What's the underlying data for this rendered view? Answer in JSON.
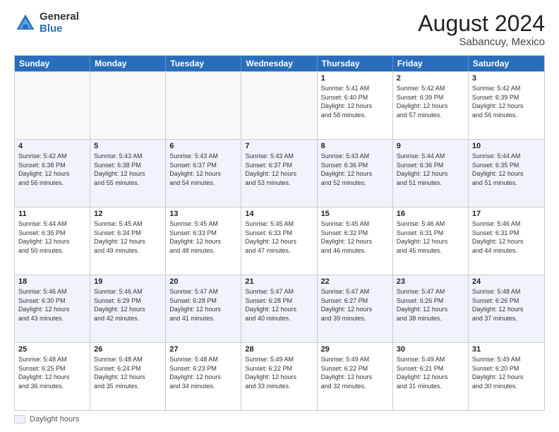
{
  "logo": {
    "general": "General",
    "blue": "Blue"
  },
  "title": "August 2024",
  "location": "Sabancuy, Mexico",
  "days_header": [
    "Sunday",
    "Monday",
    "Tuesday",
    "Wednesday",
    "Thursday",
    "Friday",
    "Saturday"
  ],
  "legend_text": "Daylight hours",
  "rows": [
    [
      {
        "day": "",
        "lines": []
      },
      {
        "day": "",
        "lines": []
      },
      {
        "day": "",
        "lines": []
      },
      {
        "day": "",
        "lines": []
      },
      {
        "day": "1",
        "lines": [
          "Sunrise: 5:41 AM",
          "Sunset: 6:40 PM",
          "Daylight: 12 hours",
          "and 58 minutes."
        ]
      },
      {
        "day": "2",
        "lines": [
          "Sunrise: 5:42 AM",
          "Sunset: 6:39 PM",
          "Daylight: 12 hours",
          "and 57 minutes."
        ]
      },
      {
        "day": "3",
        "lines": [
          "Sunrise: 5:42 AM",
          "Sunset: 6:39 PM",
          "Daylight: 12 hours",
          "and 56 minutes."
        ]
      }
    ],
    [
      {
        "day": "4",
        "lines": [
          "Sunrise: 5:42 AM",
          "Sunset: 6:38 PM",
          "Daylight: 12 hours",
          "and 56 minutes."
        ]
      },
      {
        "day": "5",
        "lines": [
          "Sunrise: 5:43 AM",
          "Sunset: 6:38 PM",
          "Daylight: 12 hours",
          "and 55 minutes."
        ]
      },
      {
        "day": "6",
        "lines": [
          "Sunrise: 5:43 AM",
          "Sunset: 6:37 PM",
          "Daylight: 12 hours",
          "and 54 minutes."
        ]
      },
      {
        "day": "7",
        "lines": [
          "Sunrise: 5:43 AM",
          "Sunset: 6:37 PM",
          "Daylight: 12 hours",
          "and 53 minutes."
        ]
      },
      {
        "day": "8",
        "lines": [
          "Sunrise: 5:43 AM",
          "Sunset: 6:36 PM",
          "Daylight: 12 hours",
          "and 52 minutes."
        ]
      },
      {
        "day": "9",
        "lines": [
          "Sunrise: 5:44 AM",
          "Sunset: 6:36 PM",
          "Daylight: 12 hours",
          "and 51 minutes."
        ]
      },
      {
        "day": "10",
        "lines": [
          "Sunrise: 5:44 AM",
          "Sunset: 6:35 PM",
          "Daylight: 12 hours",
          "and 51 minutes."
        ]
      }
    ],
    [
      {
        "day": "11",
        "lines": [
          "Sunrise: 5:44 AM",
          "Sunset: 6:35 PM",
          "Daylight: 12 hours",
          "and 50 minutes."
        ]
      },
      {
        "day": "12",
        "lines": [
          "Sunrise: 5:45 AM",
          "Sunset: 6:34 PM",
          "Daylight: 12 hours",
          "and 49 minutes."
        ]
      },
      {
        "day": "13",
        "lines": [
          "Sunrise: 5:45 AM",
          "Sunset: 6:33 PM",
          "Daylight: 12 hours",
          "and 48 minutes."
        ]
      },
      {
        "day": "14",
        "lines": [
          "Sunrise: 5:45 AM",
          "Sunset: 6:33 PM",
          "Daylight: 12 hours",
          "and 47 minutes."
        ]
      },
      {
        "day": "15",
        "lines": [
          "Sunrise: 5:45 AM",
          "Sunset: 6:32 PM",
          "Daylight: 12 hours",
          "and 46 minutes."
        ]
      },
      {
        "day": "16",
        "lines": [
          "Sunrise: 5:46 AM",
          "Sunset: 6:31 PM",
          "Daylight: 12 hours",
          "and 45 minutes."
        ]
      },
      {
        "day": "17",
        "lines": [
          "Sunrise: 5:46 AM",
          "Sunset: 6:31 PM",
          "Daylight: 12 hours",
          "and 44 minutes."
        ]
      }
    ],
    [
      {
        "day": "18",
        "lines": [
          "Sunrise: 5:46 AM",
          "Sunset: 6:30 PM",
          "Daylight: 12 hours",
          "and 43 minutes."
        ]
      },
      {
        "day": "19",
        "lines": [
          "Sunrise: 5:46 AM",
          "Sunset: 6:29 PM",
          "Daylight: 12 hours",
          "and 42 minutes."
        ]
      },
      {
        "day": "20",
        "lines": [
          "Sunrise: 5:47 AM",
          "Sunset: 6:28 PM",
          "Daylight: 12 hours",
          "and 41 minutes."
        ]
      },
      {
        "day": "21",
        "lines": [
          "Sunrise: 5:47 AM",
          "Sunset: 6:28 PM",
          "Daylight: 12 hours",
          "and 40 minutes."
        ]
      },
      {
        "day": "22",
        "lines": [
          "Sunrise: 5:47 AM",
          "Sunset: 6:27 PM",
          "Daylight: 12 hours",
          "and 39 minutes."
        ]
      },
      {
        "day": "23",
        "lines": [
          "Sunrise: 5:47 AM",
          "Sunset: 6:26 PM",
          "Daylight: 12 hours",
          "and 38 minutes."
        ]
      },
      {
        "day": "24",
        "lines": [
          "Sunrise: 5:48 AM",
          "Sunset: 6:26 PM",
          "Daylight: 12 hours",
          "and 37 minutes."
        ]
      }
    ],
    [
      {
        "day": "25",
        "lines": [
          "Sunrise: 5:48 AM",
          "Sunset: 6:25 PM",
          "Daylight: 12 hours",
          "and 36 minutes."
        ]
      },
      {
        "day": "26",
        "lines": [
          "Sunrise: 5:48 AM",
          "Sunset: 6:24 PM",
          "Daylight: 12 hours",
          "and 35 minutes."
        ]
      },
      {
        "day": "27",
        "lines": [
          "Sunrise: 5:48 AM",
          "Sunset: 6:23 PM",
          "Daylight: 12 hours",
          "and 34 minutes."
        ]
      },
      {
        "day": "28",
        "lines": [
          "Sunrise: 5:49 AM",
          "Sunset: 6:22 PM",
          "Daylight: 12 hours",
          "and 33 minutes."
        ]
      },
      {
        "day": "29",
        "lines": [
          "Sunrise: 5:49 AM",
          "Sunset: 6:22 PM",
          "Daylight: 12 hours",
          "and 32 minutes."
        ]
      },
      {
        "day": "30",
        "lines": [
          "Sunrise: 5:49 AM",
          "Sunset: 6:21 PM",
          "Daylight: 12 hours",
          "and 31 minutes."
        ]
      },
      {
        "day": "31",
        "lines": [
          "Sunrise: 5:49 AM",
          "Sunset: 6:20 PM",
          "Daylight: 12 hours",
          "and 30 minutes."
        ]
      }
    ]
  ]
}
